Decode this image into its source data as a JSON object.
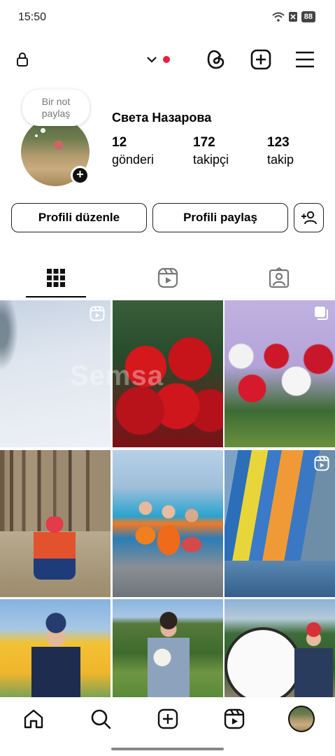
{
  "status_bar": {
    "time": "15:50",
    "battery": "88"
  },
  "note": {
    "line1": "Bir not",
    "line2": "paylaş"
  },
  "profile": {
    "name": "Света Назарова",
    "stats": [
      {
        "value": "12",
        "label": "gönderi"
      },
      {
        "value": "172",
        "label": "takipçi"
      },
      {
        "value": "123",
        "label": "takip"
      }
    ]
  },
  "buttons": {
    "edit_profile": "Profili düzenle",
    "share_profile": "Profili paylaş"
  },
  "tabs": [
    "grid",
    "reels",
    "tagged"
  ],
  "grid": {
    "watermark": "Semsa",
    "posts": [
      {
        "type": "reel",
        "subject": "snowy forest ground"
      },
      {
        "type": "photo",
        "subject": "red roses bouquet"
      },
      {
        "type": "carousel",
        "subject": "roses with white lilies and cat figurine"
      },
      {
        "type": "photo",
        "subject": "boy in pine forest"
      },
      {
        "type": "photo",
        "subject": "kids at waterpark"
      },
      {
        "type": "reel",
        "subject": "waterslides"
      },
      {
        "type": "photo",
        "subject": "boy by yellow letters"
      },
      {
        "type": "photo",
        "subject": "woman with flowers in park"
      },
      {
        "type": "photo",
        "subject": "boy by big flower clock"
      }
    ]
  },
  "colors": {
    "accent_dot": "#ed1c40",
    "text": "#000000"
  },
  "bottom_nav": [
    "home",
    "search",
    "create",
    "reels",
    "profile"
  ]
}
